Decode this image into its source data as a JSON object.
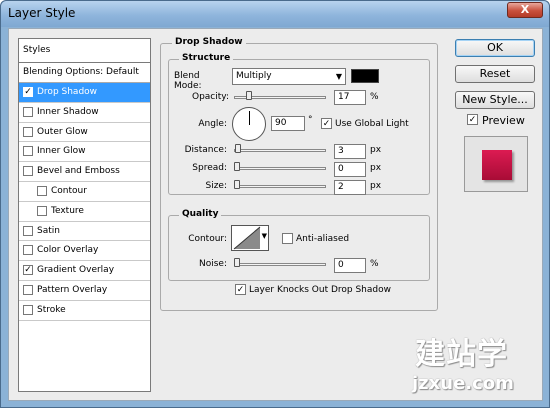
{
  "window": {
    "title": "Layer Style",
    "close_glyph": "X"
  },
  "styles_panel": {
    "header": "Styles",
    "blending_options": "Blending Options: Default",
    "items": [
      {
        "label": "Drop Shadow",
        "checked": true,
        "selected": true,
        "indent": false
      },
      {
        "label": "Inner Shadow",
        "checked": false,
        "selected": false,
        "indent": false
      },
      {
        "label": "Outer Glow",
        "checked": false,
        "selected": false,
        "indent": false
      },
      {
        "label": "Inner Glow",
        "checked": false,
        "selected": false,
        "indent": false
      },
      {
        "label": "Bevel and Emboss",
        "checked": false,
        "selected": false,
        "indent": false
      },
      {
        "label": "Contour",
        "checked": false,
        "selected": false,
        "indent": true
      },
      {
        "label": "Texture",
        "checked": false,
        "selected": false,
        "indent": true
      },
      {
        "label": "Satin",
        "checked": false,
        "selected": false,
        "indent": false
      },
      {
        "label": "Color Overlay",
        "checked": false,
        "selected": false,
        "indent": false
      },
      {
        "label": "Gradient Overlay",
        "checked": true,
        "selected": false,
        "indent": false
      },
      {
        "label": "Pattern Overlay",
        "checked": false,
        "selected": false,
        "indent": false
      },
      {
        "label": "Stroke",
        "checked": false,
        "selected": false,
        "indent": false
      }
    ]
  },
  "drop_shadow": {
    "section_title": "Drop Shadow",
    "structure_title": "Structure",
    "blend_mode_label": "Blend Mode:",
    "blend_mode_value": "Multiply",
    "shadow_color": "#000000",
    "opacity_label": "Opacity:",
    "opacity_value": "17",
    "opacity_unit": "%",
    "angle_label": "Angle:",
    "angle_value": "90",
    "angle_unit": "°",
    "global_light_label": "Use Global Light",
    "global_light_checked": true,
    "distance_label": "Distance:",
    "distance_value": "3",
    "spread_label": "Spread:",
    "spread_value": "0",
    "size_label": "Size:",
    "size_value": "2",
    "px_unit": "px",
    "percent_unit": "%",
    "quality_title": "Quality",
    "contour_label": "Contour:",
    "anti_aliased_label": "Anti-aliased",
    "anti_aliased_checked": false,
    "noise_label": "Noise:",
    "noise_value": "0",
    "knockout_label": "Layer Knocks Out Drop Shadow",
    "knockout_checked": true
  },
  "buttons": {
    "ok": "OK",
    "reset": "Reset",
    "new_style": "New Style...",
    "preview_label": "Preview",
    "preview_checked": true
  },
  "watermark": {
    "chinese": "建站学",
    "url": "jzxue.com"
  },
  "colors": {
    "selection": "#3399ff",
    "preview_fill": "#c8103f",
    "dialog_bg": "#ececec"
  }
}
